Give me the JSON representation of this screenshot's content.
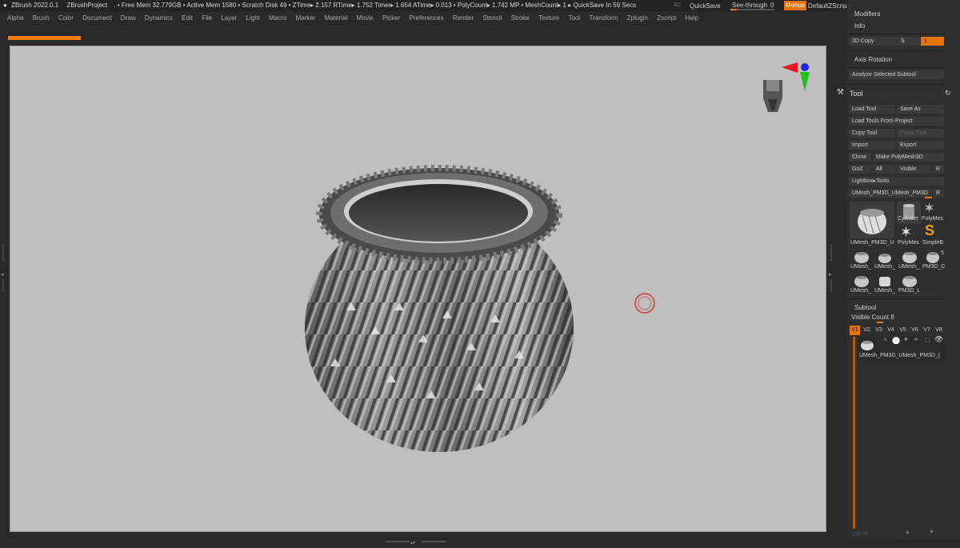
{
  "titlebar": {
    "app": "ZBrush 2022.0.1",
    "project": "ZBrushProject",
    "stats": ". • Free Mem 32.779GB • Active Mem 1580 • Scratch Disk 49 •  ZTime▸ 2.157 RTime▸ 1.752 Timer▸ 1.654 ATime▸ 0.013 • PolyCount▸ 1.742 MP  • MeshCount▸ 1  ▸ QuickSave In 59 Secs",
    "ac": "AC",
    "quicksave": "QuickSave",
    "seethrough": "See-through",
    "seethrough_value": "0",
    "menus": "Menus",
    "defaultzscript": "DefaultZScript"
  },
  "menubar": [
    "Alpha",
    "Brush",
    "Color",
    "Document",
    "Draw",
    "Dynamics",
    "Edit",
    "File",
    "Layer",
    "Light",
    "Macro",
    "Marker",
    "Material",
    "Movie",
    "Picker",
    "Preferences",
    "Render",
    "Stencil",
    "Stroke",
    "Texture",
    "Tool",
    "Transform",
    "Zplugin",
    "Zscript",
    "Help"
  ],
  "panel": {
    "modifiers": "Modifiers",
    "info": "Info",
    "copy3d": "3D Copy",
    "s_label": "S",
    "s_value": "1",
    "axis_rotation": "Axis Rotation",
    "analyze": "Analyze Selected Subtool",
    "tool_header": "Tool",
    "load_tool": "Load Tool",
    "save_as": "Save As",
    "load_from_project": "Load Tools From Project",
    "copy_tool": "Copy Tool",
    "paste_tool": "Paste Tool",
    "import": "Import",
    "export": "Export",
    "clone": "Clone",
    "make_polymesh": "Make PolyMesh3D",
    "goz": "GoZ",
    "all": "All",
    "visible": "Visible",
    "r": "R",
    "lightbox_tools": "Lightbox▸Tools",
    "current_tool": "UMesh_PM3D_UMesh_PM3D",
    "current_tool_r": "R",
    "thumb_main_label": "UMesh_PM3D_U",
    "thumb_cyl_label": "Cylinder",
    "thumb_poly_label": "PolyMes",
    "thumb_poly2_label": "PolyMes",
    "thumb_simple_label": "SimpleB",
    "small_labels": [
      "UMesh_",
      "UMesh_",
      "UMesh_",
      "PM3D_C",
      "UMesh_",
      "UMesh_",
      "PM3D_L"
    ],
    "small_number": "5",
    "subtool_header": "Subtool",
    "visible_count": "Visible Count 8",
    "vslots": [
      "V1",
      "V2",
      "V3",
      "V4",
      "V5",
      "V6",
      "V7",
      "V8"
    ],
    "subtool_item": "UMesh_PM3D_UMesh_PM3D_(",
    "list_all": "List All"
  }
}
